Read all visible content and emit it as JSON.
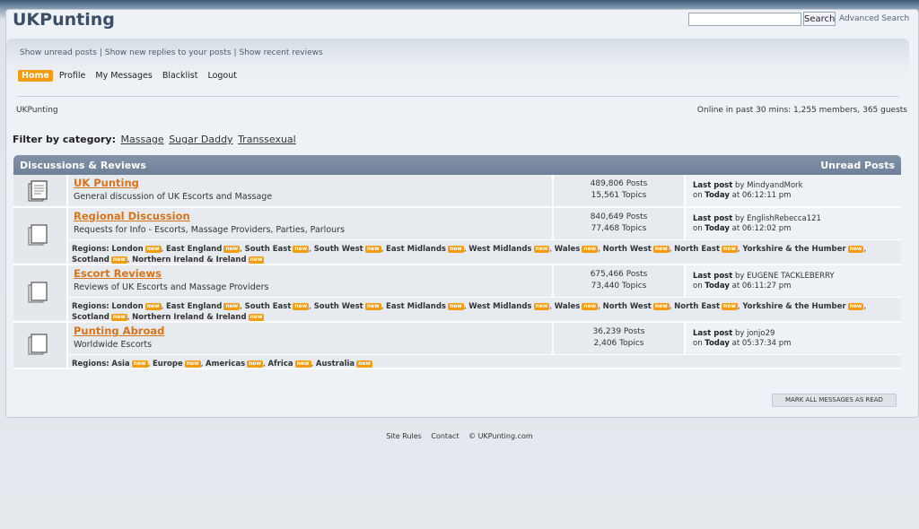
{
  "site": {
    "title": "UKPunting"
  },
  "search": {
    "placeholder": "",
    "button_label": "Search",
    "advanced_label": "Advanced Search"
  },
  "quick_links": [
    "Show unread posts",
    "Show new replies to your posts",
    "Show recent reviews"
  ],
  "main_nav": [
    "Home",
    "Profile",
    "My Messages",
    "Blacklist",
    "Logout"
  ],
  "breadcrumb": "UKPunting",
  "online": "Online in past 30 mins: 1,255 members, 365 guests",
  "filter": {
    "label": "Filter by category:",
    "items": [
      "Massage",
      "Sugar Daddy",
      "Transsexual"
    ]
  },
  "table": {
    "header_left": "Discussions & Reviews",
    "header_right": "Unread Posts"
  },
  "forums": [
    {
      "title": "UK Punting",
      "desc": "General discussion of UK Escorts and Massage",
      "posts": "489,806 Posts",
      "topics": "15,561 Topics",
      "last_label": "Last post",
      "last_by": "by MindyandMork",
      "last_on": "on",
      "last_day": "Today",
      "last_time": "at 06:12:11 pm"
    },
    {
      "title": "Regional Discussion",
      "desc": "Requests for Info - Escorts, Massage Providers, Parties, Parlours",
      "posts": "840,649 Posts",
      "topics": "77,468 Topics",
      "last_label": "Last post",
      "last_by": "by EnglishRebecca121",
      "last_on": "on",
      "last_day": "Today",
      "last_time": "at 06:12:02 pm"
    },
    {
      "title": "Escort Reviews",
      "desc": "Reviews of UK Escorts and Massage Providers",
      "posts": "675,466 Posts",
      "topics": "73,440 Topics",
      "last_label": "Last post",
      "last_by": "by EUGENE TACKLEBERRY",
      "last_on": "on",
      "last_day": "Today",
      "last_time": "at 06:11:27 pm"
    },
    {
      "title": "Punting Abroad",
      "desc": "Worldwide Escorts",
      "posts": "36,239 Posts",
      "topics": "2,406 Topics",
      "last_label": "Last post",
      "last_by": "by jonjo29",
      "last_on": "on",
      "last_day": "Today",
      "last_time": "at 05:37:34 pm"
    }
  ],
  "regions_label": "Regions:",
  "new_badge": "new",
  "uk_regions": [
    "London",
    "East England",
    "South East",
    "South West",
    "East Midlands",
    "West Midlands",
    "Wales",
    "North West",
    "North East",
    "Yorkshire & the Humber",
    "Scotland",
    "Northern Ireland & Ireland"
  ],
  "world_regions": [
    "Asia",
    "Europe",
    "Americas",
    "Africa",
    "Australia"
  ],
  "mark_all": "MARK ALL MESSAGES AS READ",
  "footer": [
    "Site Rules",
    "Contact",
    "© UKPunting.com"
  ]
}
